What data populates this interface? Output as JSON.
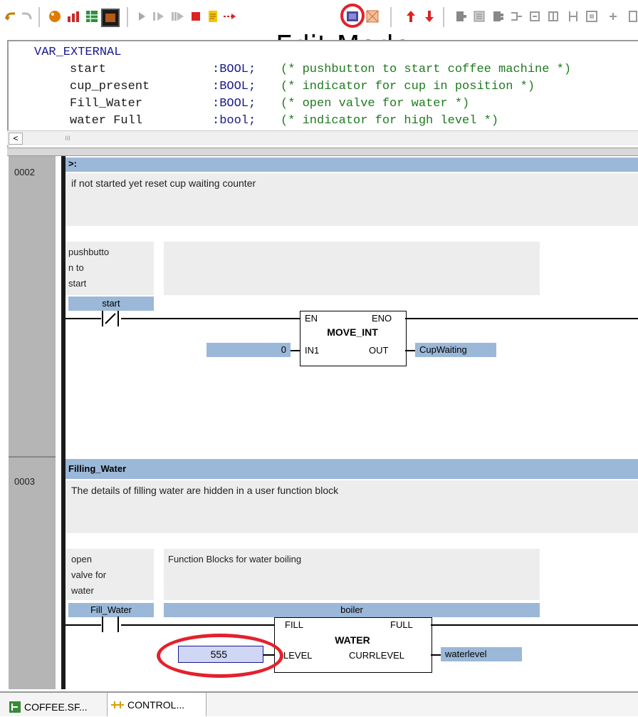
{
  "annotation": {
    "edit_mode_label": "Edit Mode"
  },
  "declarations": {
    "keyword": "VAR_EXTERNAL",
    "vars": [
      {
        "name": "start",
        "type": ":BOOL;",
        "comment": "(* pushbutton to start coffee machine *)"
      },
      {
        "name": "cup_present",
        "type": ":BOOL;",
        "comment": "(* indicator for cup in position *)"
      },
      {
        "name": "Fill_Water",
        "type": ":BOOL;",
        "comment": "(* open valve for water *)"
      },
      {
        "name": "water Full",
        "type": ":bool;",
        "comment": "(* indicator for high level *)"
      }
    ],
    "scroll_left": "<",
    "scroll_thumb": "III"
  },
  "networks": [
    {
      "number": "0002",
      "label": ">:",
      "comment": "if not started yet reset cup waiting counter",
      "contact_comment": "pushbutto\nn to\nstart",
      "contact_var": "start",
      "fb_type": "MOVE_INT",
      "pins": {
        "en": "EN",
        "eno": "ENO",
        "in1": "IN1",
        "out": "OUT"
      },
      "in1_value": "0",
      "out_var": "CupWaiting"
    },
    {
      "number": "0003",
      "label": "Filling_Water",
      "comment": "The details of filling water are hidden in a user function block",
      "contact_comment": "open\nvalve for\nwater",
      "fb_comment": "Function Blocks for water boiling",
      "contact_var": "Fill_Water",
      "fb_instance": "boiler",
      "fb_type": "WATER",
      "pins": {
        "fill": "FILL",
        "full": "FULL",
        "level": "LEVEL",
        "currlevel": "CURRLEVEL"
      },
      "level_value": "555",
      "out_var": "waterlevel"
    }
  ],
  "tabs": [
    {
      "label": "COFFEE.SF..."
    },
    {
      "label": "CONTROL..."
    }
  ],
  "colors": {
    "accent_red": "#e5202c",
    "var_blue": "#9bb8d8"
  }
}
